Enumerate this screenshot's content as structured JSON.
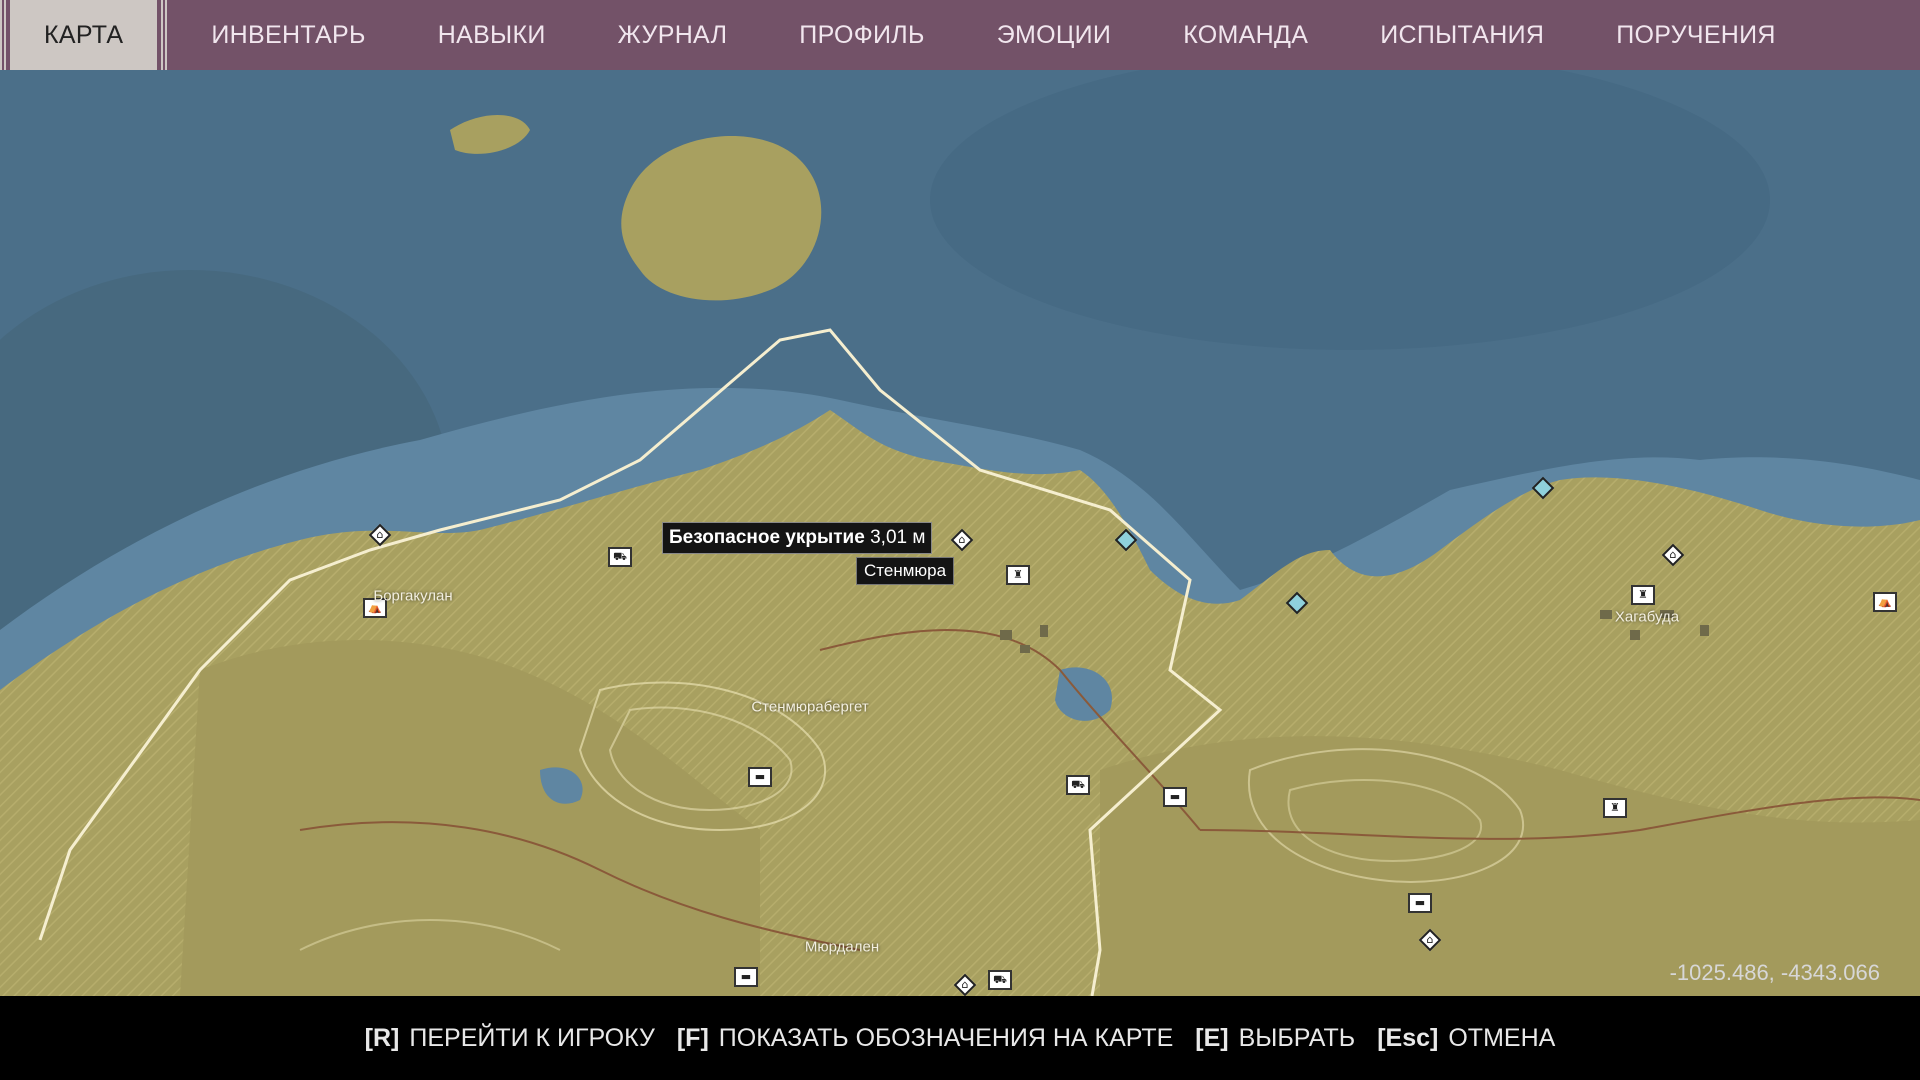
{
  "nav": {
    "tabs": [
      {
        "label": "КАРТА"
      },
      {
        "label": "ИНВЕНТАРЬ"
      },
      {
        "label": "НАВЫКИ"
      },
      {
        "label": "ЖУРНАЛ"
      },
      {
        "label": "ПРОФИЛЬ"
      },
      {
        "label": "ЭМОЦИИ"
      },
      {
        "label": "КОМАНДА"
      },
      {
        "label": "ИСПЫТАНИЯ"
      },
      {
        "label": "ПОРУЧЕНИЯ"
      }
    ]
  },
  "map": {
    "tooltip": {
      "title": "Безопасное укрытие",
      "distance": "3,01 м"
    },
    "subtooltip": "Стенмюра",
    "place_labels": [
      "Боргакулан",
      "Стенмюрабергет",
      "Хагабуда",
      "Мюрдален"
    ],
    "coords": "-1025.486, -4343.066",
    "colors": {
      "water": "#4b6f89",
      "land": "#a8a060",
      "border": "#f5eecf",
      "topbar": "#735268"
    }
  },
  "hints": [
    {
      "key": "[R]",
      "label": "ПЕРЕЙТИ К ИГРОКУ"
    },
    {
      "key": "[F]",
      "label": "ПОКАЗАТЬ ОБОЗНАЧЕНИЯ НА КАРТЕ"
    },
    {
      "key": "[E]",
      "label": "ВЫБРАТЬ"
    },
    {
      "key": "[Esc]",
      "label": "ОТМЕНА"
    }
  ]
}
